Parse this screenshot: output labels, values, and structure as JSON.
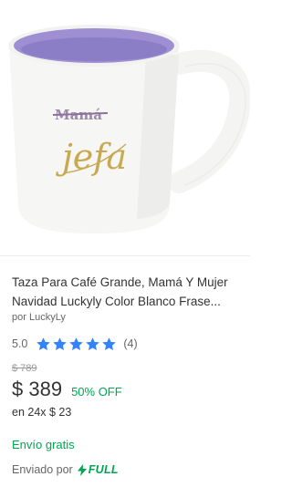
{
  "product": {
    "image_alt": "mug-photo",
    "mug_text_crossed": "Mamá",
    "mug_text_script": "jefa",
    "title": "Taza Para Café Grande, Mamá Y Mujer Navidad Luckyly Color Blanco Frase...",
    "seller": "por LuckyLy",
    "rating_value": "5.0",
    "rating_stars": 5,
    "rating_max": 5,
    "rating_count": "(4)",
    "original_price": "$ 789",
    "price": "$ 389",
    "discount": "50% OFF",
    "installments": "en 24x $ 23",
    "shipping": "Envío gratis",
    "fulfillment_label": "Enviado por",
    "fulfillment_brand": "FULL"
  },
  "colors": {
    "accent_green": "#00a650",
    "star_blue": "#3483fa",
    "mug_inner_purple": "#9d8fd1"
  }
}
